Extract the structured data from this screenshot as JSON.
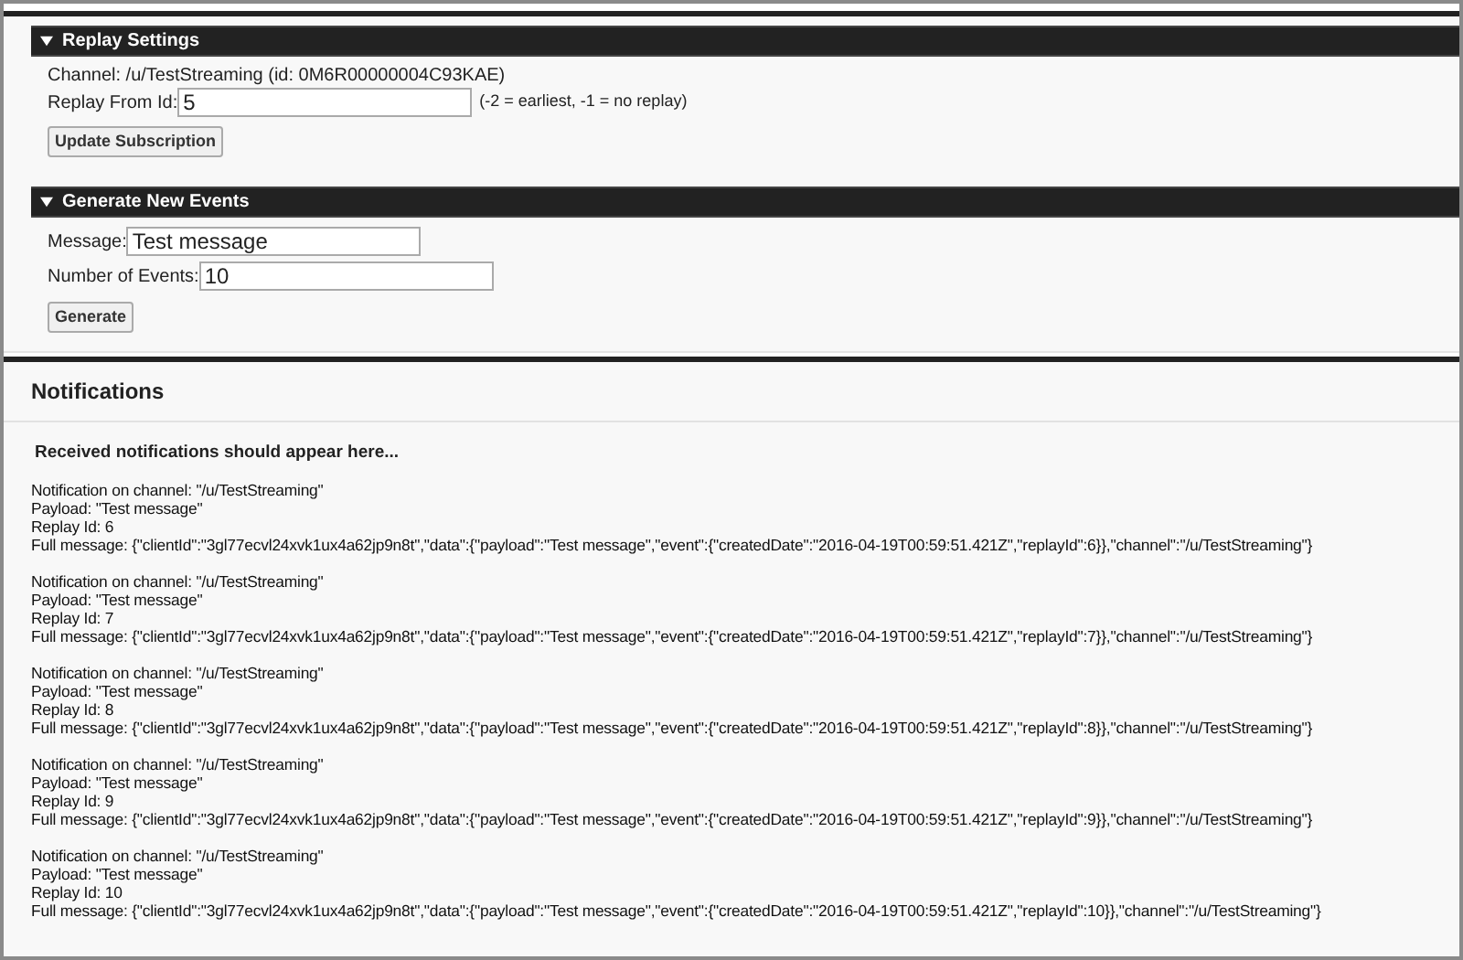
{
  "replay_settings": {
    "title": "Replay Settings",
    "expanded": true,
    "channel": "Channel:  /u/TestStreaming (id:  0M6R00000004C93KAE)",
    "replay_from_id": {
      "label": "Replay From Id:",
      "value": "5",
      "hint": "(-2 = earliest, -1 = no replay)"
    },
    "button": "Update Subscription"
  },
  "generate_new_events": {
    "title": "Generate New Events",
    "expanded": true,
    "message": {
      "label": "Message:",
      "value": "Test message"
    },
    "number_of_events": {
      "label": "Number of Events:",
      "value": "10"
    },
    "button": "Generate"
  },
  "notifications": {
    "title": "Notifications",
    "intro": "Received notifications should appear here...",
    "items": [
      {
        "channel": "Notification on channel: \"/u/TestStreaming\"",
        "payload": "Payload: \"Test message\"",
        "replay_id": "Replay Id: 6",
        "full_message": "Full message: {\"clientId\":\"3gl77ecvl24xvk1ux4a62jp9n8t\",\"data\":{\"payload\":\"Test message\",\"event\":{\"createdDate\":\"2016-04-19T00:59:51.421Z\",\"replayId\":6}},\"channel\":\"/u/TestStreaming\"}"
      },
      {
        "channel": "Notification on channel: \"/u/TestStreaming\"",
        "payload": "Payload: \"Test message\"",
        "replay_id": "Replay Id: 7",
        "full_message": "Full message: {\"clientId\":\"3gl77ecvl24xvk1ux4a62jp9n8t\",\"data\":{\"payload\":\"Test message\",\"event\":{\"createdDate\":\"2016-04-19T00:59:51.421Z\",\"replayId\":7}},\"channel\":\"/u/TestStreaming\"}"
      },
      {
        "channel": "Notification on channel: \"/u/TestStreaming\"",
        "payload": "Payload: \"Test message\"",
        "replay_id": "Replay Id: 8",
        "full_message": "Full message: {\"clientId\":\"3gl77ecvl24xvk1ux4a62jp9n8t\",\"data\":{\"payload\":\"Test message\",\"event\":{\"createdDate\":\"2016-04-19T00:59:51.421Z\",\"replayId\":8}},\"channel\":\"/u/TestStreaming\"}"
      },
      {
        "channel": "Notification on channel: \"/u/TestStreaming\"",
        "payload": "Payload: \"Test message\"",
        "replay_id": "Replay Id: 9",
        "full_message": "Full message: {\"clientId\":\"3gl77ecvl24xvk1ux4a62jp9n8t\",\"data\":{\"payload\":\"Test message\",\"event\":{\"createdDate\":\"2016-04-19T00:59:51.421Z\",\"replayId\":9}},\"channel\":\"/u/TestStreaming\"}"
      },
      {
        "channel": "Notification on channel: \"/u/TestStreaming\"",
        "payload": "Payload: \"Test message\"",
        "replay_id": "Replay Id: 10",
        "full_message": "Full message: {\"clientId\":\"3gl77ecvl24xvk1ux4a62jp9n8t\",\"data\":{\"payload\":\"Test message\",\"event\":{\"createdDate\":\"2016-04-19T00:59:51.421Z\",\"replayId\":10}},\"channel\":\"/u/TestStreaming\"}"
      }
    ]
  }
}
